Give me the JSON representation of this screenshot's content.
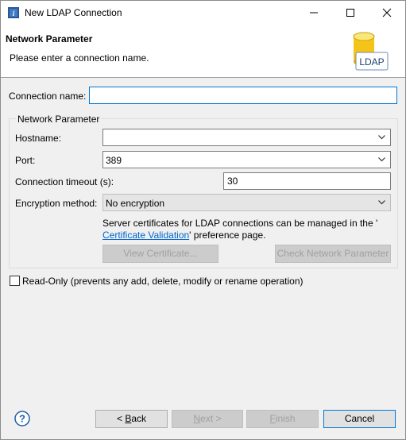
{
  "window": {
    "title": "New LDAP Connection"
  },
  "icons": {
    "app": "app-icon",
    "minimize": "minimize-icon",
    "maximize": "maximize-icon",
    "close": "close-icon",
    "ldap": "ldap-database-icon",
    "help": "help-icon",
    "dropdown": "chevron-down-icon"
  },
  "banner": {
    "title": "Network Parameter",
    "description": "Please enter a connection name.",
    "icon_label": "LDAP"
  },
  "form": {
    "connection_name_label": "Connection name:",
    "connection_name_value": "",
    "group_title": "Network Parameter",
    "hostname_label": "Hostname:",
    "hostname_value": "",
    "port_label": "Port:",
    "port_value": "389",
    "timeout_label": "Connection timeout (s):",
    "timeout_value": "30",
    "encryption_label": "Encryption method:",
    "encryption_value": "No encryption",
    "cert_text_1": "Server certificates for LDAP connections can be managed in the '",
    "cert_link": "Certificate Validation",
    "cert_text_2": "' preference page.",
    "view_cert_button": "View Certificate...",
    "check_network_button": "Check Network Parameter",
    "readonly_label": "Read-Only (prevents any add, delete, modify or rename operation)",
    "readonly_checked": false
  },
  "footer": {
    "back_prefix": "< ",
    "back_mnemonic": "B",
    "back_rest": "ack",
    "next_prefix": "",
    "next_mnemonic": "N",
    "next_rest": "ext >",
    "finish_mnemonic": "F",
    "finish_rest": "inish",
    "cancel": "Cancel"
  },
  "colors": {
    "accent": "#0078d7",
    "link": "#0066cc",
    "dialog_bg": "#f0f0f0"
  }
}
